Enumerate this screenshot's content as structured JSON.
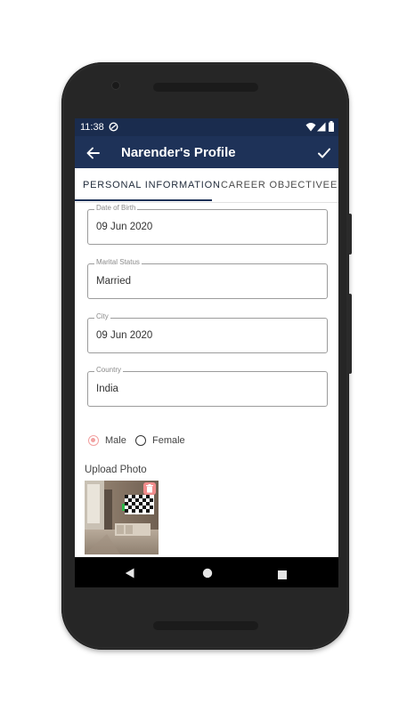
{
  "status_bar": {
    "time": "11:38"
  },
  "app_bar": {
    "title": "Narender's Profile"
  },
  "tabs": [
    {
      "label": "PERSONAL INFORMATION",
      "active": true
    },
    {
      "label": "CAREER OBJECTIVE",
      "active": false
    },
    {
      "label": "ED",
      "active": false
    }
  ],
  "fields": {
    "dob": {
      "label": "Date of Birth",
      "value": "09 Jun 2020"
    },
    "marital": {
      "label": "Marital Status",
      "value": "Married"
    },
    "city": {
      "label": "City",
      "value": "09 Jun 2020"
    },
    "country": {
      "label": "Country",
      "value": "India"
    }
  },
  "gender": {
    "options": [
      "Male",
      "Female"
    ],
    "selected": "Male"
  },
  "upload": {
    "label": "Upload Photo"
  },
  "colors": {
    "app_bar": "#1e3258",
    "status_bar": "#1a2c4e",
    "radio_selected": "#f2a1a1",
    "delete_badge": "#f28c8c"
  }
}
